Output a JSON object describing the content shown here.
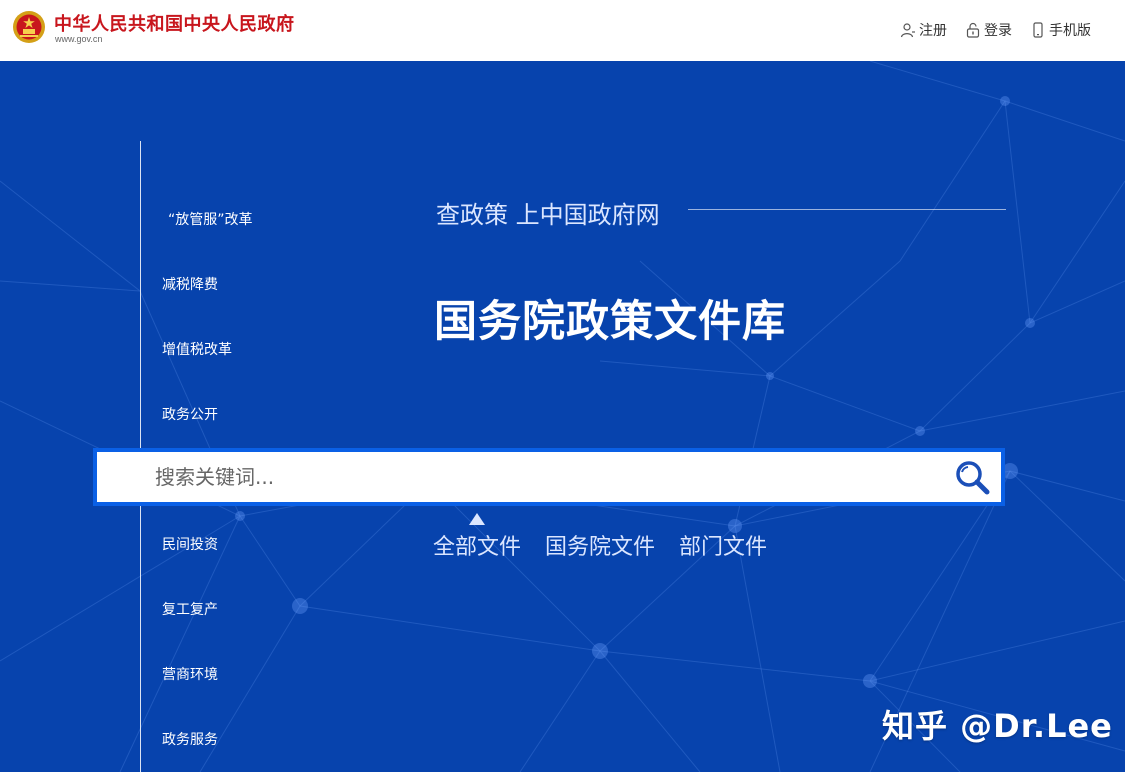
{
  "header": {
    "site_name": "中华人民共和国中央人民政府",
    "site_url": "www.gov.cn",
    "links": [
      {
        "label": "注册",
        "icon": "user-icon"
      },
      {
        "label": "登录",
        "icon": "lock-icon"
      },
      {
        "label": "手机版",
        "icon": "phone-icon"
      }
    ]
  },
  "sidebar": {
    "topics": [
      "“放管服”改革",
      "减税降费",
      "增值税改革",
      "政务公开",
      "民间投资",
      "复工复产",
      "营商环境",
      "政务服务"
    ]
  },
  "main": {
    "slogan": "查政策 上中国政府网",
    "title": "国务院政策文件库"
  },
  "search": {
    "placeholder": "搜索关键词...",
    "value": "",
    "button_icon": "search-icon"
  },
  "tabs": [
    "全部文件",
    "国务院文件",
    "部门文件"
  ],
  "watermark": "知乎 @Dr.Lee",
  "colors": {
    "banner": "#0743ad",
    "search_border": "#0a60e6",
    "site_name": "#c8161d"
  }
}
